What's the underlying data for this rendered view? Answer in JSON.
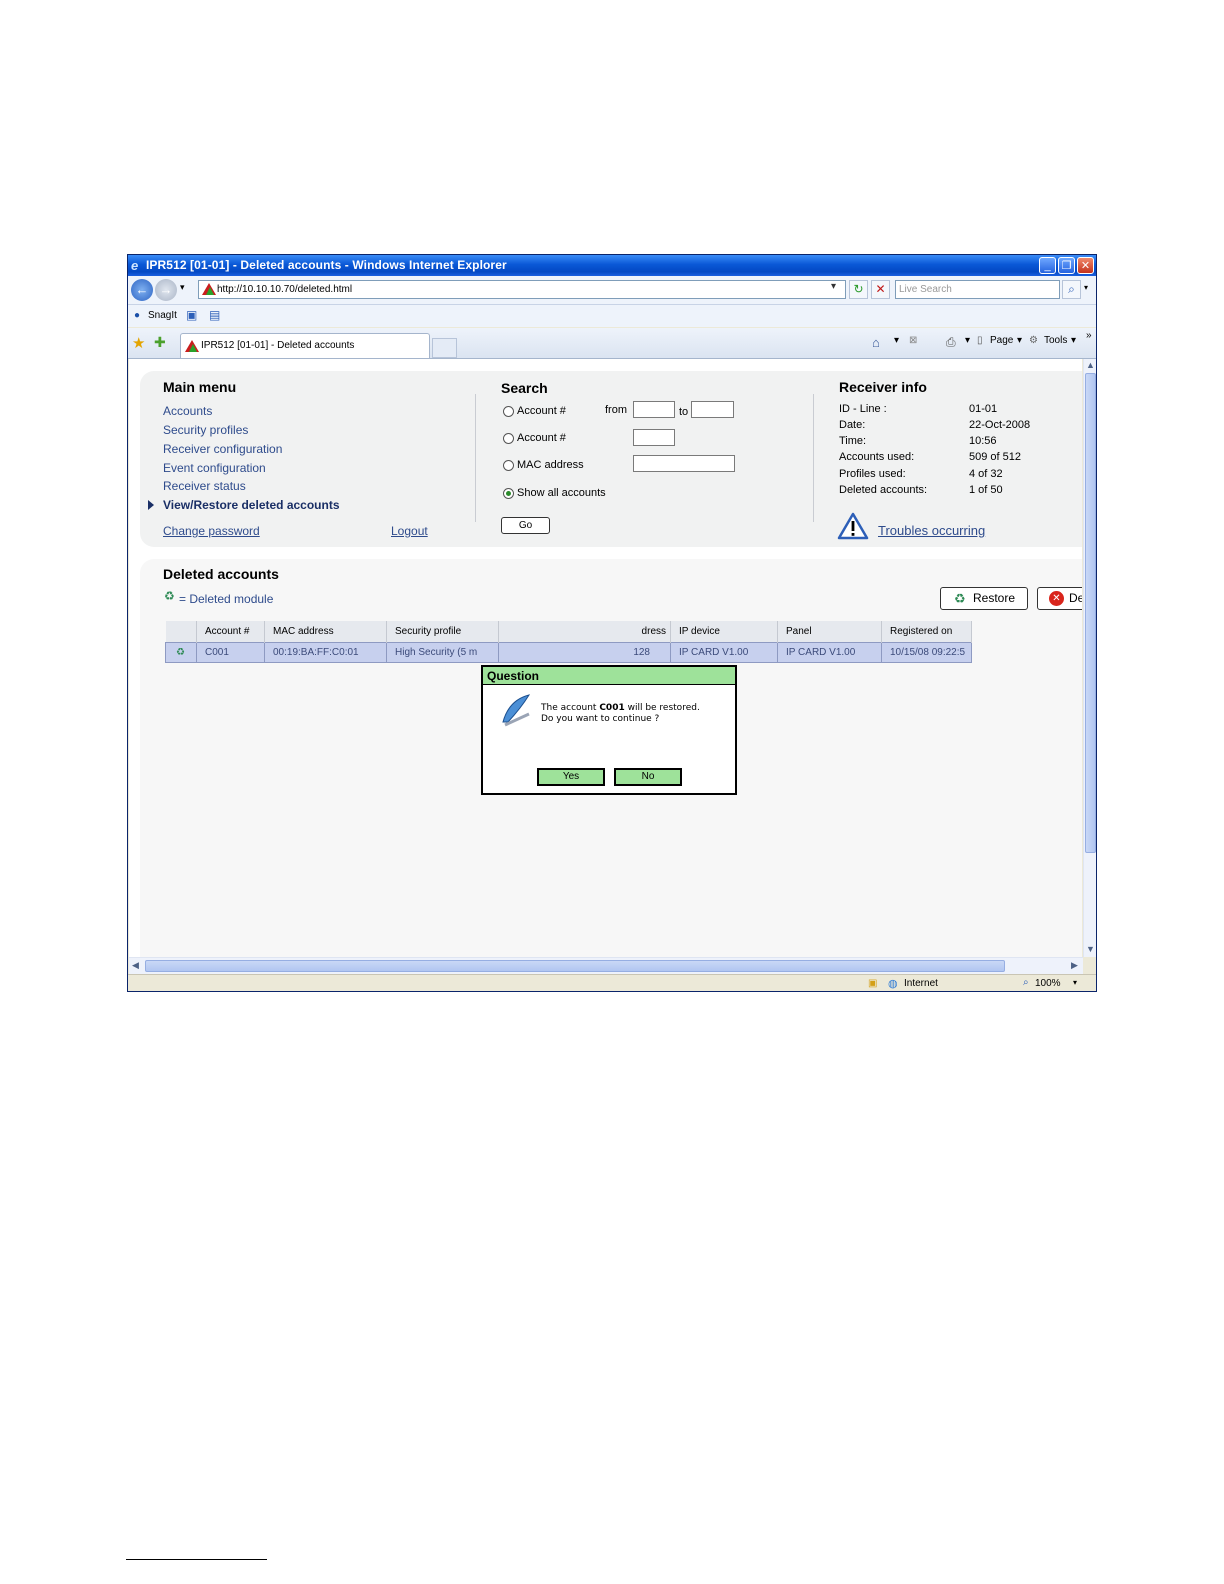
{
  "browser": {
    "title": "IPR512 [01-01] - Deleted accounts - Windows Internet Explorer",
    "url": "http://10.10.10.70/deleted.html",
    "search_placeholder": "Live Search",
    "links_bar": {
      "snagit": "SnagIt"
    },
    "tab_title": "IPR512 [01-01] - Deleted accounts",
    "command_bar": {
      "page": "Page",
      "tools": "Tools"
    },
    "status": {
      "zone": "Internet",
      "zoom": "100%"
    }
  },
  "main_menu": {
    "title": "Main menu",
    "items": [
      {
        "label": "Accounts"
      },
      {
        "label": "Security profiles"
      },
      {
        "label": "Receiver configuration"
      },
      {
        "label": "Event configuration"
      },
      {
        "label": "Receiver status"
      },
      {
        "label": "View/Restore deleted accounts",
        "active": true
      }
    ],
    "change_password": "Change password",
    "logout": "Logout"
  },
  "search": {
    "title": "Search",
    "option_account_range": "Account #",
    "from_label": "from",
    "to_label": "to",
    "option_account": "Account #",
    "option_mac": "MAC address",
    "option_show_all": "Show all accounts",
    "selected": "Show all accounts",
    "go": "Go"
  },
  "receiver_info": {
    "title": "Receiver info",
    "rows": [
      {
        "label": "ID - Line :",
        "value": "01-01"
      },
      {
        "label": "Date:",
        "value": "22-Oct-2008"
      },
      {
        "label": "Time:",
        "value": "10:56"
      },
      {
        "label": "Accounts used:",
        "value": "509 of 512"
      },
      {
        "label": "Profiles used:",
        "value": "4 of 32"
      },
      {
        "label": "Deleted accounts:",
        "value": "1 of 50"
      }
    ],
    "troubles": "Troubles occurring"
  },
  "deleted_accounts": {
    "title": "Deleted accounts",
    "legend": "= Deleted module",
    "restore_button": "Restore",
    "delete_button": "De",
    "columns": [
      "Account #",
      "MAC address",
      "Security profile",
      "IP address",
      "IP device",
      "Panel",
      "Registered on"
    ],
    "columns_visible": [
      "Account #",
      "MAC address",
      "Security profile",
      "dress",
      "IP device",
      "Panel",
      "Registered on"
    ],
    "rows": [
      {
        "account": "C001",
        "mac": "00:19:BA:FF:C0:01",
        "profile": "High Security (5 m",
        "ip_visible": "128",
        "ip_device": "IP CARD  V1.00",
        "panel": "IP CARD  V1.00",
        "registered": "10/15/08 09:22:5"
      }
    ]
  },
  "dialog": {
    "title": "Question",
    "message_prefix": "The account ",
    "message_account": "C001",
    "message_suffix": " will be restored.",
    "message_line2": "Do you want to continue ?",
    "yes": "Yes",
    "no": "No"
  },
  "colors": {
    "dialog_green": "#9ee29a",
    "selected_row": "#c7d0ee",
    "link_blue": "#2e4b8c",
    "titlebar_blue": "#0a58d6"
  }
}
